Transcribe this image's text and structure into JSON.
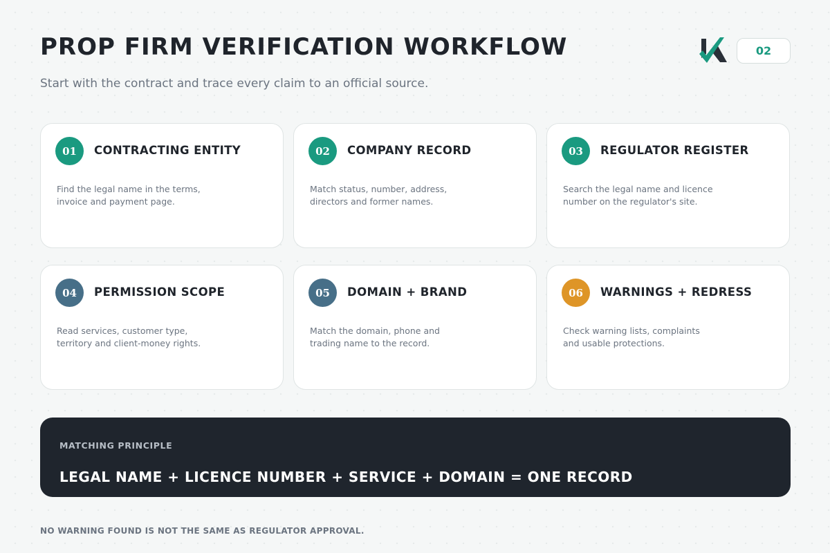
{
  "header": {
    "title": "PROP FIRM VERIFICATION WORKFLOW",
    "subtitle": "Start with the contract and trace every claim to an official source.",
    "page_number": "02",
    "logo": "k-checkmark-logo"
  },
  "colors": {
    "teal": "#1a9a80",
    "slate": "#476f88",
    "amber": "#de9527",
    "dark_panel": "#1f252d"
  },
  "steps": [
    {
      "number": "01",
      "title": "CONTRACTING ENTITY",
      "line1": "Find the legal name in the terms,",
      "line2": "invoice and payment page.",
      "color": "#1a9a80"
    },
    {
      "number": "02",
      "title": "COMPANY RECORD",
      "line1": "Match status, number, address,",
      "line2": "directors and former names.",
      "color": "#1a9a80"
    },
    {
      "number": "03",
      "title": "REGULATOR REGISTER",
      "line1": "Search the legal name and licence",
      "line2": "number on the regulator's site.",
      "color": "#1a9a80"
    },
    {
      "number": "04",
      "title": "PERMISSION SCOPE",
      "line1": "Read services, customer type,",
      "line2": "territory and client-money rights.",
      "color": "#476f88"
    },
    {
      "number": "05",
      "title": "DOMAIN + BRAND",
      "line1": "Match the domain, phone and",
      "line2": "trading name to the record.",
      "color": "#476f88"
    },
    {
      "number": "06",
      "title": "WARNINGS + REDRESS",
      "line1": "Check warning lists, complaints",
      "line2": "and usable protections.",
      "color": "#de9527"
    }
  ],
  "principle": {
    "label": "MATCHING PRINCIPLE",
    "formula": "LEGAL NAME + LICENCE NUMBER + SERVICE + DOMAIN = ONE RECORD"
  },
  "footer": {
    "note": "NO WARNING FOUND IS NOT THE SAME AS REGULATOR APPROVAL."
  }
}
